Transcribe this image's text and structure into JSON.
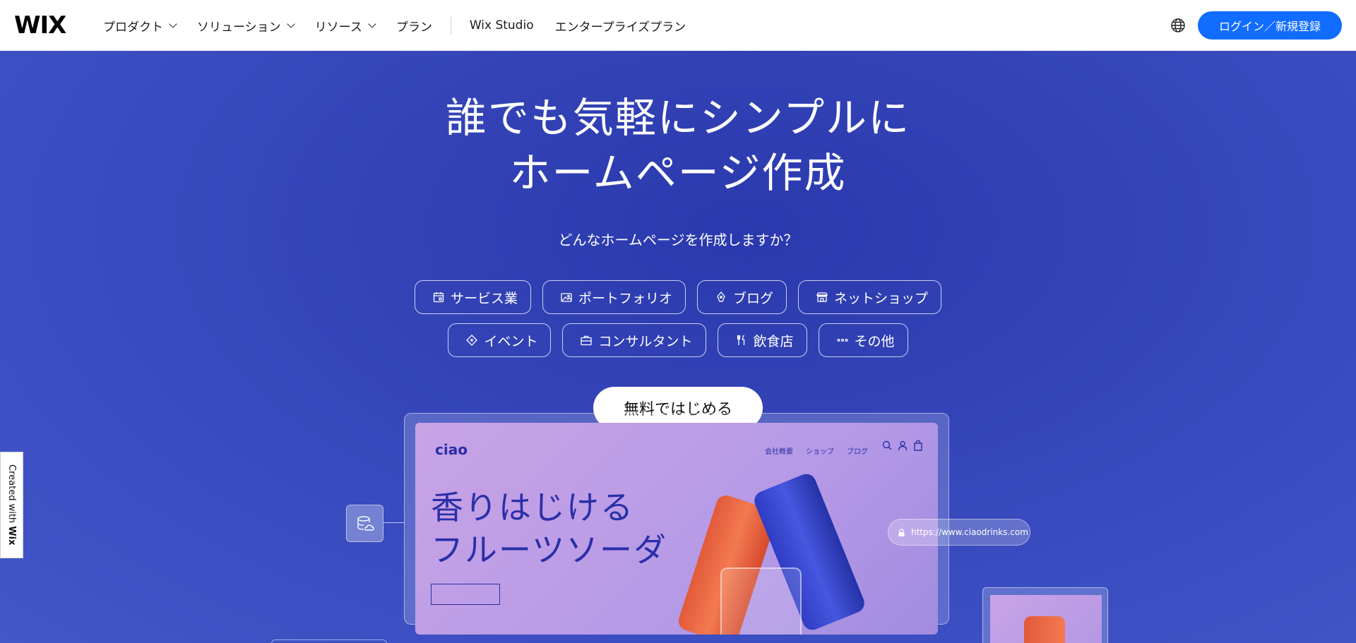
{
  "header": {
    "logo": "WIX",
    "nav": [
      {
        "label": "プロダクト",
        "has_dropdown": true
      },
      {
        "label": "ソリューション",
        "has_dropdown": true
      },
      {
        "label": "リソース",
        "has_dropdown": true
      },
      {
        "label": "プラン",
        "has_dropdown": false
      }
    ],
    "nav_secondary": [
      {
        "label": "Wix Studio"
      },
      {
        "label": "エンタープライズプラン"
      }
    ],
    "language_icon": "globe-icon",
    "login_label": "ログイン／新規登録",
    "accent": "#116dff"
  },
  "hero": {
    "title_line1": "誰でも気軽にシンプルに",
    "title_line2": "ホームページ作成",
    "subtitle": "どんなホームページを作成しますか？",
    "categories_row1": [
      {
        "label": "サービス業",
        "icon": "calendar-icon"
      },
      {
        "label": "ポートフォリオ",
        "icon": "image-icon"
      },
      {
        "label": "ブログ",
        "icon": "pen-nib-icon"
      },
      {
        "label": "ネットショップ",
        "icon": "store-icon"
      }
    ],
    "categories_row2": [
      {
        "label": "イベント",
        "icon": "ticket-icon"
      },
      {
        "label": "コンサルタント",
        "icon": "briefcase-icon"
      },
      {
        "label": "飲食店",
        "icon": "cutlery-icon"
      },
      {
        "label": "その他",
        "icon": "more-dots-icon"
      }
    ],
    "cta_label": "無料ではじめる",
    "background": "#3444b7"
  },
  "preview": {
    "logo": "ciao",
    "nav": [
      "会社概要",
      "ショップ",
      "ブログ"
    ],
    "title_line1": "香りはじける",
    "title_line2": "フルーツソーダ",
    "url": "https://www.ciaodrinks.com"
  },
  "badge": {
    "prefix": "Created with ",
    "brand": "Wix"
  }
}
